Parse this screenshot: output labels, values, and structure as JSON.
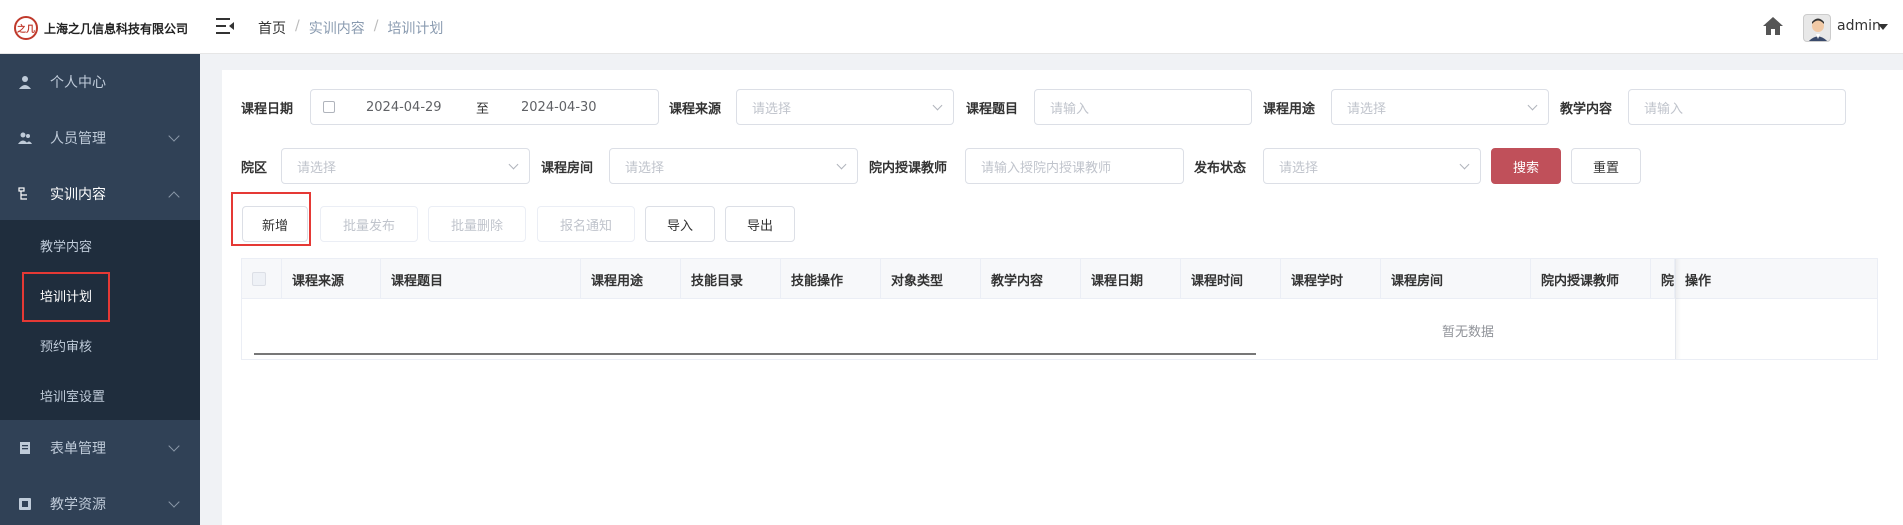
{
  "header": {
    "company": "上海之几信息科技有限公司",
    "logo_mark": "之几",
    "breadcrumb": [
      "首页",
      "实训内容",
      "培训计划"
    ],
    "user": "admin"
  },
  "sidebar": {
    "items": [
      {
        "label": "个人中心",
        "icon": "user-icon"
      },
      {
        "label": "人员管理",
        "icon": "users-icon"
      },
      {
        "label": "实训内容",
        "icon": "tree-icon"
      },
      {
        "label": "表单管理",
        "icon": "form-icon"
      },
      {
        "label": "教学资源",
        "icon": "resource-icon"
      }
    ],
    "submenu": [
      "教学内容",
      "培训计划",
      "预约审核",
      "培训室设置"
    ]
  },
  "filters": {
    "course_date_label": "课程日期",
    "date_start": "2024-04-29",
    "date_to": "至",
    "date_end": "2024-04-30",
    "course_source_label": "课程来源",
    "course_source_placeholder": "请选择",
    "course_topic_label": "课程题目",
    "course_topic_placeholder": "请输入",
    "course_use_label": "课程用途",
    "course_use_placeholder": "请选择",
    "teach_content_label": "教学内容",
    "teach_content_placeholder": "请输入",
    "campus_label": "院区",
    "campus_placeholder": "请选择",
    "room_label": "课程房间",
    "room_placeholder": "请选择",
    "teacher_label": "院内授课教师",
    "teacher_placeholder": "请输入授院内授课教师",
    "publish_label": "发布状态",
    "publish_placeholder": "请选择",
    "search": "搜索",
    "reset": "重置"
  },
  "toolbar": {
    "add": "新增",
    "batch_publish": "批量发布",
    "batch_delete": "批量删除",
    "signup_notice": "报名通知",
    "import": "导入",
    "export": "导出"
  },
  "table": {
    "columns": [
      "课程来源",
      "课程题目",
      "课程用途",
      "技能目录",
      "技能操作",
      "对象类型",
      "教学内容",
      "课程日期",
      "课程时间",
      "课程学时",
      "课程房间",
      "院内授课教师",
      "院",
      "操作"
    ],
    "empty": "暂无数据"
  }
}
